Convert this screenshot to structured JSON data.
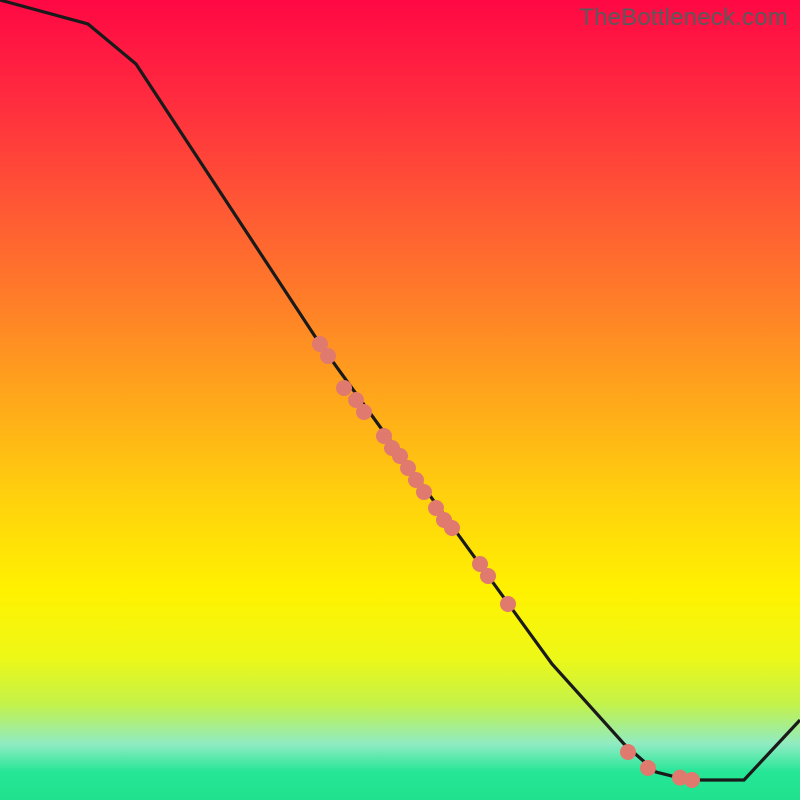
{
  "watermark": "TheBottleneck.com",
  "chart_data": {
    "type": "line",
    "title": "",
    "xlabel": "",
    "ylabel": "",
    "xlim": [
      0,
      100
    ],
    "ylim": [
      0,
      100
    ],
    "curve": [
      {
        "x": 0,
        "y": 100
      },
      {
        "x": 11,
        "y": 97
      },
      {
        "x": 17,
        "y": 92
      },
      {
        "x": 40,
        "y": 57
      },
      {
        "x": 69,
        "y": 17
      },
      {
        "x": 78,
        "y": 7
      },
      {
        "x": 82,
        "y": 3.5
      },
      {
        "x": 86,
        "y": 2.5
      },
      {
        "x": 93,
        "y": 2.5
      },
      {
        "x": 100,
        "y": 10
      }
    ],
    "points": [
      {
        "x": 40,
        "y": 57
      },
      {
        "x": 41,
        "y": 55.5
      },
      {
        "x": 43,
        "y": 51.5
      },
      {
        "x": 44.5,
        "y": 50
      },
      {
        "x": 45.5,
        "y": 48.5
      },
      {
        "x": 48,
        "y": 45.5
      },
      {
        "x": 49,
        "y": 44
      },
      {
        "x": 50,
        "y": 43
      },
      {
        "x": 51,
        "y": 41.5
      },
      {
        "x": 52,
        "y": 40
      },
      {
        "x": 53,
        "y": 38.5
      },
      {
        "x": 54.5,
        "y": 36.5
      },
      {
        "x": 55.5,
        "y": 35
      },
      {
        "x": 56.5,
        "y": 34
      },
      {
        "x": 60,
        "y": 29.5
      },
      {
        "x": 61,
        "y": 28
      },
      {
        "x": 63.5,
        "y": 24.5
      },
      {
        "x": 78.5,
        "y": 6
      },
      {
        "x": 81,
        "y": 4
      },
      {
        "x": 85,
        "y": 2.8
      },
      {
        "x": 86.5,
        "y": 2.5
      }
    ],
    "gradient_stops": [
      {
        "offset": 0.0,
        "color": "#ff0844"
      },
      {
        "offset": 0.12,
        "color": "#ff2a3f"
      },
      {
        "offset": 0.25,
        "color": "#ff5535"
      },
      {
        "offset": 0.38,
        "color": "#ff7f28"
      },
      {
        "offset": 0.5,
        "color": "#ffa81a"
      },
      {
        "offset": 0.62,
        "color": "#ffd00d"
      },
      {
        "offset": 0.74,
        "color": "#fff200"
      },
      {
        "offset": 0.82,
        "color": "#eef816"
      },
      {
        "offset": 0.88,
        "color": "#c4f249"
      },
      {
        "offset": 0.93,
        "color": "#8febc3"
      },
      {
        "offset": 0.965,
        "color": "#25e696"
      },
      {
        "offset": 1.0,
        "color": "#20e28d"
      }
    ],
    "point_color": "#e07a6e",
    "curve_color": "#1a1a1a"
  }
}
